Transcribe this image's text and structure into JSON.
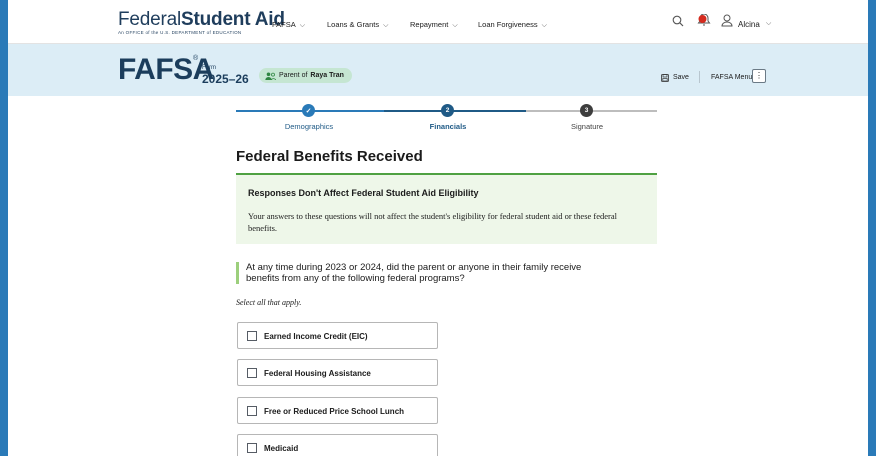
{
  "header": {
    "logo_text_regular": "Federal",
    "logo_text_bold": "Student Aid",
    "logo_subtitle": "An OFFICE of the U.S. DEPARTMENT of EDUCATION",
    "nav": [
      {
        "label": "FAFSA"
      },
      {
        "label": "Loans & Grants"
      },
      {
        "label": "Repayment"
      },
      {
        "label": "Loan Forgiveness"
      }
    ],
    "user_name": "Alcina"
  },
  "fafsa_header": {
    "brand": "FAFSA",
    "registered": "®",
    "form_label": "Form",
    "form_year": "2025–26",
    "parent_prefix": "Parent of",
    "parent_name": "Raya Tran",
    "save_label": "Save",
    "menu_label": "FAFSA Menu",
    "menu_button_glyph": "⋮"
  },
  "stepper": {
    "steps": [
      {
        "label": "Demographics",
        "number": "✓",
        "state": "complete"
      },
      {
        "label": "Financials",
        "number": "2",
        "state": "current"
      },
      {
        "label": "Signature",
        "number": "3",
        "state": "upcoming"
      }
    ]
  },
  "main": {
    "title": "Federal Benefits Received",
    "notice": {
      "title": "Responses Don't Affect Federal Student Aid Eligibility",
      "body": "Your answers to these questions will not affect the student's eligibility for federal student aid or these federal benefits."
    },
    "question": "At any time during 2023 or 2024, did the parent or anyone in their family receive benefits from any of the following federal programs?",
    "hint": "Select all that apply.",
    "options": [
      {
        "label": "Earned Income Credit (EIC)",
        "checked": false
      },
      {
        "label": "Federal Housing Assistance",
        "checked": false
      },
      {
        "label": "Free or Reduced Price School Lunch",
        "checked": false
      },
      {
        "label": "Medicaid",
        "checked": false
      }
    ]
  },
  "colors": {
    "navy": "#1b3d5c",
    "step_complete": "#2a7ab8",
    "step_current": "#1f5a86",
    "step_upcoming": "#3d3d3d",
    "notice_border": "#4fa142",
    "notice_bg": "#eef7e9",
    "band_bg": "#dcedf6",
    "pill_bg": "#c5e6d2",
    "notification": "#d52b1e"
  }
}
